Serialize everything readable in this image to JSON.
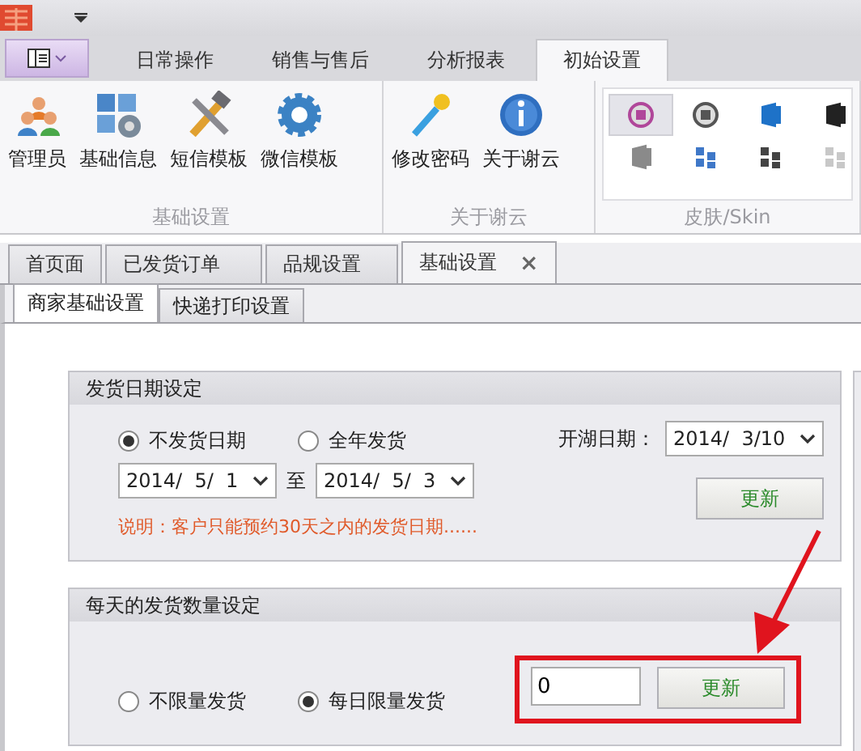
{
  "ribbon": {
    "tabs": [
      {
        "label": "日常操作",
        "selected": false
      },
      {
        "label": "销售与售后",
        "selected": false
      },
      {
        "label": "分析报表",
        "selected": false
      },
      {
        "label": "初始设置",
        "selected": true
      }
    ],
    "groups": [
      {
        "label": "基础设置",
        "buttons": [
          {
            "label": "管理员",
            "kind": "users"
          },
          {
            "label": "基础信息",
            "kind": "tiles"
          },
          {
            "label": "短信模板",
            "kind": "tools"
          },
          {
            "label": "微信模板",
            "kind": "gear"
          }
        ]
      },
      {
        "label": "关于谢云",
        "buttons": [
          {
            "label": "修改密码",
            "kind": "key"
          },
          {
            "label": "关于谢云",
            "kind": "info"
          }
        ]
      }
    ],
    "skin_group": {
      "label": "皮肤/Skin",
      "skins": [
        {
          "kind": "badge",
          "color": "#b0479a",
          "selected": true
        },
        {
          "kind": "badge",
          "color": "#555555",
          "selected": false
        },
        {
          "kind": "office",
          "color": "#1e72c8",
          "selected": false
        },
        {
          "kind": "office",
          "color": "#222222",
          "selected": false
        },
        {
          "kind": "office",
          "color": "#8a8a8a",
          "selected": false
        },
        {
          "kind": "tiles",
          "color": "#3f78c8",
          "selected": false
        },
        {
          "kind": "tiles",
          "color": "#444444",
          "selected": false
        },
        {
          "kind": "tiles",
          "color": "#c8c8c8",
          "selected": false
        }
      ]
    }
  },
  "doc_tabs": [
    {
      "label": "首页面",
      "selected": false,
      "closable": false
    },
    {
      "label": "已发货订单",
      "selected": false,
      "closable": false
    },
    {
      "label": "品规设置",
      "selected": false,
      "closable": false
    },
    {
      "label": "基础设置",
      "selected": true,
      "closable": true,
      "close": "×"
    }
  ],
  "sub_tabs": [
    {
      "label": "商家基础设置",
      "selected": true
    },
    {
      "label": "快递打印设置",
      "selected": false
    }
  ],
  "date_panel": {
    "title": "发货日期设定",
    "options": [
      {
        "label": "不发货日期",
        "selected": true
      },
      {
        "label": "全年发货",
        "selected": false
      }
    ],
    "from": "2014/  5/  1",
    "between": "至",
    "to": "2014/  5/  3",
    "note": "说明：客户只能预约30天之内的发货日期......",
    "open_label": "开湖日期：",
    "open_date": "2014/  3/10",
    "button": "更新"
  },
  "quantity_panel": {
    "title": "每天的发货数量设定",
    "options": [
      {
        "label": "不限量发货",
        "selected": false
      },
      {
        "label": "每日限量发货",
        "selected": true
      }
    ],
    "value": "0",
    "button": "更新"
  }
}
